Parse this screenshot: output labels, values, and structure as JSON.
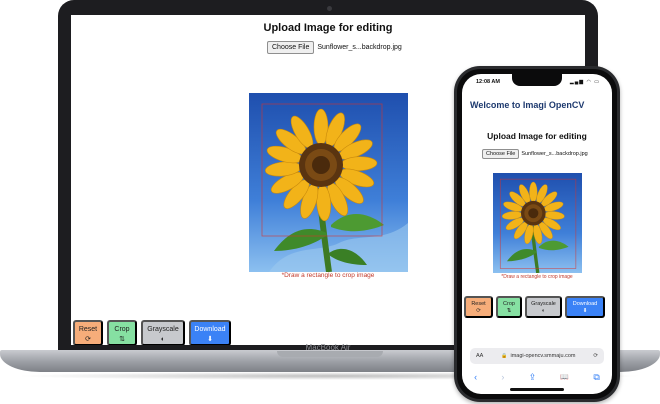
{
  "laptop": {
    "model_label": "MacBook Air",
    "page": {
      "title": "Upload Image for editing",
      "choose_file_label": "Choose File",
      "file_name": "Sunflower_s...backdrop.jpg",
      "crop_hint": "*Draw a rectangle to crop image"
    },
    "buttons": [
      {
        "label": "Reset",
        "icon": "reset-icon",
        "glyph": "⟳",
        "color": "#f6ad7a"
      },
      {
        "label": "Crop",
        "icon": "crop-icon",
        "glyph": "⇅",
        "color": "#86e0a2"
      },
      {
        "label": "Grayscale",
        "icon": "contrast-icon",
        "glyph": "◐",
        "color": "#c7c9cd"
      },
      {
        "label": "Download",
        "icon": "download-icon",
        "glyph": "⬇",
        "color": "#3b82f6"
      }
    ]
  },
  "phone": {
    "status": {
      "time": "12:08 AM",
      "indicators": "▂▄▆ ◠ ▭"
    },
    "app_header": "Welcome to Imagi OpenCV",
    "page": {
      "title": "Upload Image for editing",
      "choose_file_label": "Choose File",
      "file_name": "Sunflower_s...backdrop.jpg",
      "crop_hint": "*Draw a rectangle to crop image"
    },
    "buttons": [
      {
        "label": "Reset",
        "icon": "reset-icon",
        "glyph": "⟳"
      },
      {
        "label": "Crop",
        "icon": "crop-icon",
        "glyph": "⇅"
      },
      {
        "label": "Grayscale",
        "icon": "contrast-icon",
        "glyph": "◐"
      },
      {
        "label": "Download",
        "icon": "download-icon",
        "glyph": "⬇"
      }
    ],
    "address_bar": {
      "text_size_label": "AA",
      "url": "imagi-opencv.smmaju.com",
      "lock_glyph": "🔒",
      "reload_glyph": "⟳"
    },
    "toolbar": {
      "back": "‹",
      "forward": "›",
      "share": "⇪",
      "bookmarks": "📖",
      "tabs": "⧉"
    }
  },
  "colors": {
    "accent_blue": "#3b82f6",
    "header_navy": "#1e3a6f",
    "hint_red": "#c0392b"
  }
}
